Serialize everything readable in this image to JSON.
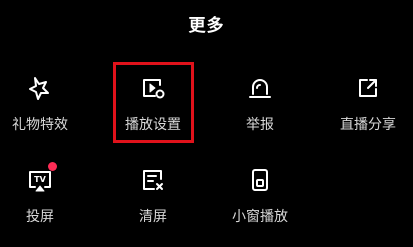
{
  "header": {
    "title": "更多"
  },
  "grid": {
    "row1": [
      {
        "id": "gift-effects",
        "label": "礼物特效",
        "icon": "sparkle-star-icon"
      },
      {
        "id": "playback-settings",
        "label": "播放设置",
        "icon": "play-settings-icon",
        "highlighted": true
      },
      {
        "id": "report",
        "label": "举报",
        "icon": "alarm-siren-icon"
      },
      {
        "id": "live-share",
        "label": "直播分享",
        "icon": "share-arrow-icon"
      }
    ],
    "row2": [
      {
        "id": "cast-screen",
        "label": "投屏",
        "icon": "tv-cast-icon",
        "badge": "red-dot"
      },
      {
        "id": "clear-screen",
        "label": "清屏",
        "icon": "clear-screen-icon"
      },
      {
        "id": "mini-window",
        "label": "小窗播放",
        "icon": "mini-window-icon"
      }
    ]
  },
  "colors": {
    "background": "#000000",
    "text": "#ffffff",
    "label": "#d8d8d8",
    "highlight_border": "#e0121b",
    "badge": "#fe2c55"
  }
}
